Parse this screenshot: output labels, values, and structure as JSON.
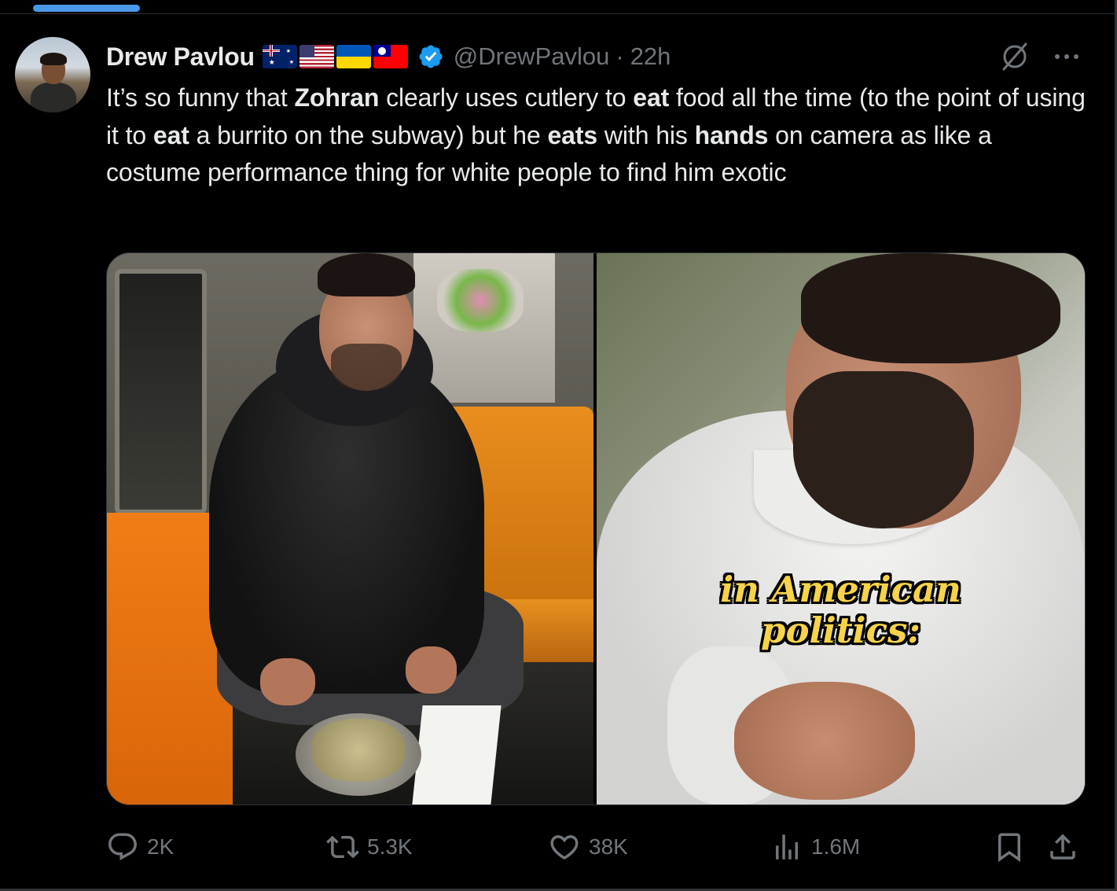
{
  "tweet": {
    "author_name": "Drew Pavlou",
    "handle": "@DrewPavlou",
    "separator": "·",
    "time": "22h",
    "flags": [
      "australia-flag",
      "usa-flag",
      "ukraine-flag",
      "taiwan-flag"
    ],
    "text_segments": [
      {
        "t": "It’s so funny that ",
        "b": false
      },
      {
        "t": "Zohran",
        "b": true
      },
      {
        "t": " clearly uses cutlery to ",
        "b": false
      },
      {
        "t": "eat",
        "b": true
      },
      {
        "t": " food all the time (to the point of using it to ",
        "b": false
      },
      {
        "t": "eat",
        "b": true
      },
      {
        "t": " a burrito on the subway) but he ",
        "b": false
      },
      {
        "t": "eats",
        "b": true
      },
      {
        "t": " with his ",
        "b": false
      },
      {
        "t": "hands",
        "b": true
      },
      {
        "t": " on camera as like a costume performance thing for white people to find him exotic",
        "b": false
      }
    ],
    "media": {
      "right_caption_line1": "in American",
      "right_caption_line2": "politics:"
    },
    "actions": {
      "replies": "2K",
      "reposts": "5.3K",
      "likes": "38K",
      "views": "1.6M"
    }
  },
  "colors": {
    "background": "#000000",
    "text_primary": "#e7e9ea",
    "text_secondary": "#71767b",
    "verified_blue": "#1d9bf0",
    "caption_yellow": "#f6d34a"
  }
}
